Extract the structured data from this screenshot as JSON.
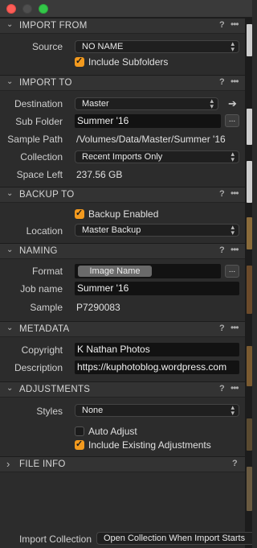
{
  "sections": {
    "import_from": {
      "title": "IMPORT FROM",
      "source_label": "Source",
      "source_value": "NO NAME",
      "include_subfolders_label": "Include Subfolders",
      "include_subfolders_checked": true
    },
    "import_to": {
      "title": "IMPORT TO",
      "destination_label": "Destination",
      "destination_value": "Master",
      "subfolder_label": "Sub Folder",
      "subfolder_value": "Summer '16",
      "sample_path_label": "Sample Path",
      "sample_path_value": "/Volumes/Data/Master/Summer '16",
      "collection_label": "Collection",
      "collection_value": "Recent Imports Only",
      "space_left_label": "Space Left",
      "space_left_value": "237.56 GB"
    },
    "backup_to": {
      "title": "BACKUP TO",
      "backup_enabled_label": "Backup Enabled",
      "backup_enabled_checked": true,
      "location_label": "Location",
      "location_value": "Master Backup"
    },
    "naming": {
      "title": "NAMING",
      "format_label": "Format",
      "format_token": "Image Name",
      "job_name_label": "Job name",
      "job_name_value": "Summer '16",
      "sample_label": "Sample",
      "sample_value": "P7290083"
    },
    "metadata": {
      "title": "METADATA",
      "copyright_label": "Copyright",
      "copyright_value": "K Nathan Photos",
      "description_label": "Description",
      "description_value": "https://kuphotoblog.wordpress.com"
    },
    "adjustments": {
      "title": "ADJUSTMENTS",
      "styles_label": "Styles",
      "styles_value": "None",
      "auto_adjust_label": "Auto Adjust",
      "auto_adjust_checked": false,
      "include_existing_label": "Include Existing Adjustments",
      "include_existing_checked": true
    },
    "file_info": {
      "title": "FILE INFO"
    }
  },
  "bottom": {
    "import_collection_label": "Import Collection",
    "import_collection_value": "Open Collection When Import Starts"
  },
  "common": {
    "help_glyph": "?",
    "more_glyph": "•••",
    "ellipsis_glyph": "...",
    "chevron_open": "⌄",
    "chevron_closed": "›",
    "arrow_glyph": "➔"
  },
  "colors": {
    "accent_checkbox": "#f39a1e",
    "close": "#fc5d57",
    "zoom": "#33c748",
    "panel_bg": "#2c2c2c",
    "field_bg": "#121212"
  }
}
